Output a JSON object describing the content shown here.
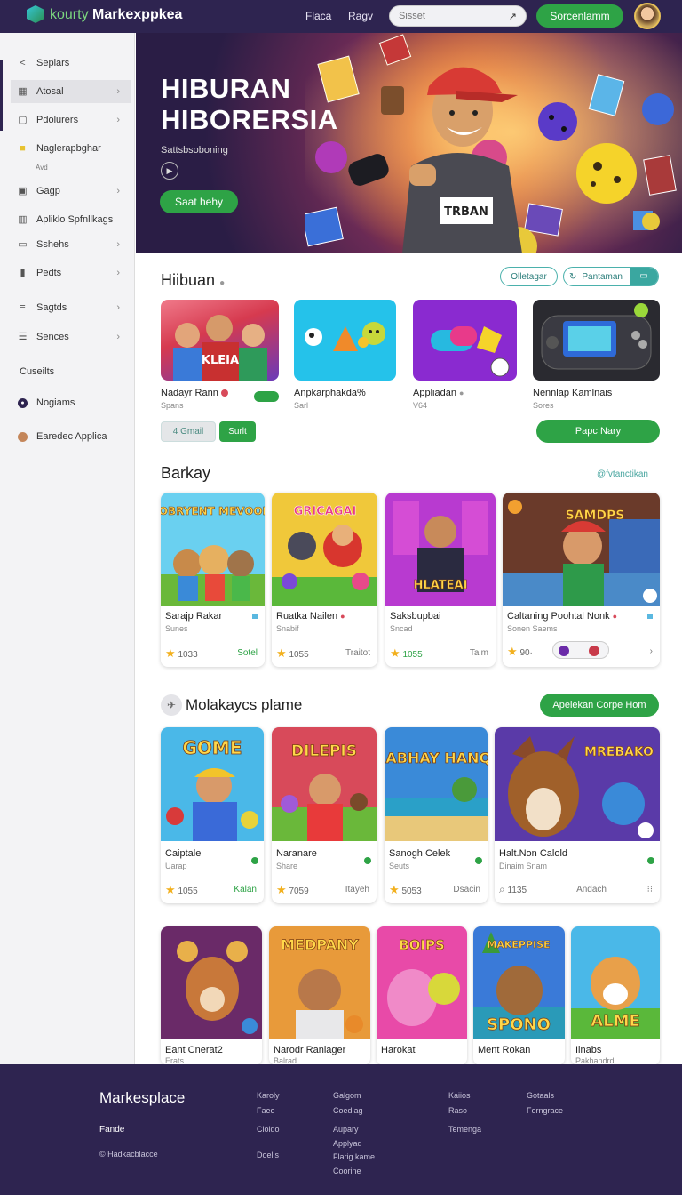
{
  "header": {
    "logo_prefix": "kourty",
    "logo_text": "Markexppkea",
    "nav": [
      "Flaca",
      "Ragv"
    ],
    "search_placeholder": "Sisset",
    "signin_label": "Sorcenlamm"
  },
  "sidebar": {
    "items": [
      {
        "label": "Seplars"
      },
      {
        "label": "Atosal"
      },
      {
        "label": "Pdolurers"
      },
      {
        "label": "Naglerapbghar"
      },
      {
        "label": "Gagp"
      },
      {
        "label": "Apliklo Spfnllkags"
      },
      {
        "label": "Sshehs"
      },
      {
        "label": "Pedts"
      },
      {
        "label": "Sagtds"
      },
      {
        "label": "Sences"
      }
    ],
    "sub_label": "Avd",
    "heading": "Cuseilts",
    "extra": [
      {
        "label": "Nogiams"
      },
      {
        "label": "Earedec Applica"
      }
    ]
  },
  "hero": {
    "title_line1": "HIBURAN",
    "title_line2": "HIBORERSIA",
    "subtitle": "Sattsbsoboning",
    "cta": "Saat hehy",
    "shirt_text": "TRBAN"
  },
  "section1": {
    "title": "Hiibuan",
    "filter1": "Olletagar",
    "filter2": "Pantaman",
    "tiles": [
      {
        "name": "Nadayr Rann",
        "sub": "Spans",
        "art": "KLEIA"
      },
      {
        "name": "Anpkarphakda%",
        "sub": "Sarl"
      },
      {
        "name": "Appliadan",
        "sub": "V64"
      },
      {
        "name": "Nennlap Kamlnais",
        "sub": "Sores"
      }
    ],
    "btn_gray": "4 Gmail",
    "btn_green": "Surlt",
    "cta": "Papc Nary"
  },
  "section2": {
    "title": "Barkay",
    "link": "@fvtanctikan",
    "cards": [
      {
        "art": "HOBRYENT MEVOOE!",
        "name": "Sarajp Rakar",
        "sub": "Sunes",
        "rating": "1033",
        "tag": "Sotel"
      },
      {
        "art": "GRICAGAI",
        "name": "Ruatka Nailen",
        "sub": "Snabif",
        "rating": "1055",
        "tag": "Traitot"
      },
      {
        "art": "HLATEAI",
        "name": "Saksbupbai",
        "sub": "Sncad",
        "rating": "1055",
        "tag": "Taim"
      },
      {
        "art": "SAMDPS",
        "name": "Caltaning Poohtal Nonk",
        "sub": "Sonen Saems",
        "rating": "90·",
        "tag": ""
      }
    ]
  },
  "section3": {
    "title": "Molakaycs plame",
    "cta": "Apelekan Corpe Hom",
    "cards": [
      {
        "art": "GOME",
        "name": "Caiptale",
        "sub": "Uarap",
        "rating": "1055",
        "tag": "Kalan"
      },
      {
        "art": "DILEPIS",
        "name": "Naranare",
        "sub": "Share",
        "rating": "7059",
        "tag": "Itayeh"
      },
      {
        "art": "SABHAY HANQI",
        "name": "Sanogh Celek",
        "sub": "Seuts",
        "rating": "5053",
        "tag": "Dsacin"
      },
      {
        "art": "MREBAKO",
        "name": "Halt.Non Calold",
        "sub": "Dinaim Snam",
        "rating": "1135",
        "tag": "Andach"
      }
    ]
  },
  "section4": {
    "cards": [
      {
        "art": "",
        "name": "Eant Cnerat2",
        "sub": "Erats"
      },
      {
        "art": "MEDPANY",
        "name": "Narodr Ranlager",
        "sub": "Balrad"
      },
      {
        "art": "BOIPS",
        "name": "Harokat",
        "sub": ""
      },
      {
        "art": "MAKEPPISE SPONO",
        "name": "Ment Rokan",
        "sub": ""
      },
      {
        "art": "ALME",
        "name": "Iinabs",
        "sub": "Pakhandrd"
      }
    ]
  },
  "footer": {
    "brand": "Markesplace",
    "left_label": "Fande",
    "copyright": "Hadkacblacce",
    "col1": [
      "Karoly",
      "Faeo",
      "Cloido",
      "Doells"
    ],
    "col2": [
      "Galgom",
      "Coedlag",
      "Aupary",
      "Applyad",
      "Flarig kame",
      "Coorine"
    ],
    "col3": [
      "Kaiios",
      "Raso",
      "Temenga"
    ],
    "col4": [
      "Gotaals",
      "Forngrace"
    ]
  },
  "colors": {
    "accent": "#2ea346",
    "header": "#2e2450",
    "teal": "#4bb1ac"
  }
}
